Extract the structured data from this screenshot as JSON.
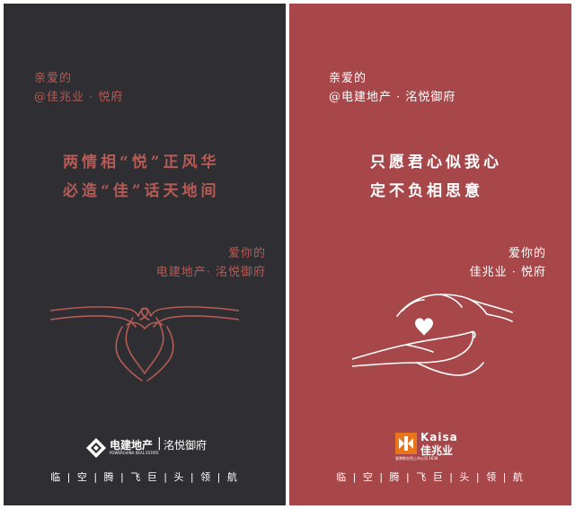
{
  "left": {
    "greeting": "亲爱的",
    "recipient": "@佳兆业 · 悦府",
    "headline_1": "两情相“悦”正风华",
    "headline_2": "必造“佳”话天地间",
    "sign_1": "爱你的",
    "sign_2": "电建地产· 洺悦御府",
    "logo_brand": "电建地产",
    "logo_sub_en": "POWERCHINA REAL ESTATE",
    "logo_project": "洺悦御府",
    "slogan": "临 | 空 | 腾 | 飞   巨 | 头 | 领 | 航",
    "colors": {
      "background": "#2f2f33",
      "accent": "#b65b55"
    }
  },
  "right": {
    "greeting": "亲爱的",
    "recipient": "@电建地产 · 洺悦御府",
    "headline_1": "只愿君心似我心",
    "headline_2": "定不负相思意",
    "sign_1": "爱你的",
    "sign_2": "佳兆业 · 悦府",
    "logo_en": "Kaisa",
    "logo_cn": "佳兆业",
    "logo_sub": "香港联交所上市公司 1638",
    "slogan": "临 | 空 | 腾 | 飞   巨 | 头 | 领 | 航",
    "colors": {
      "background": "#a8474a",
      "text": "#ffffff",
      "logo_orange": "#e8741c"
    }
  }
}
